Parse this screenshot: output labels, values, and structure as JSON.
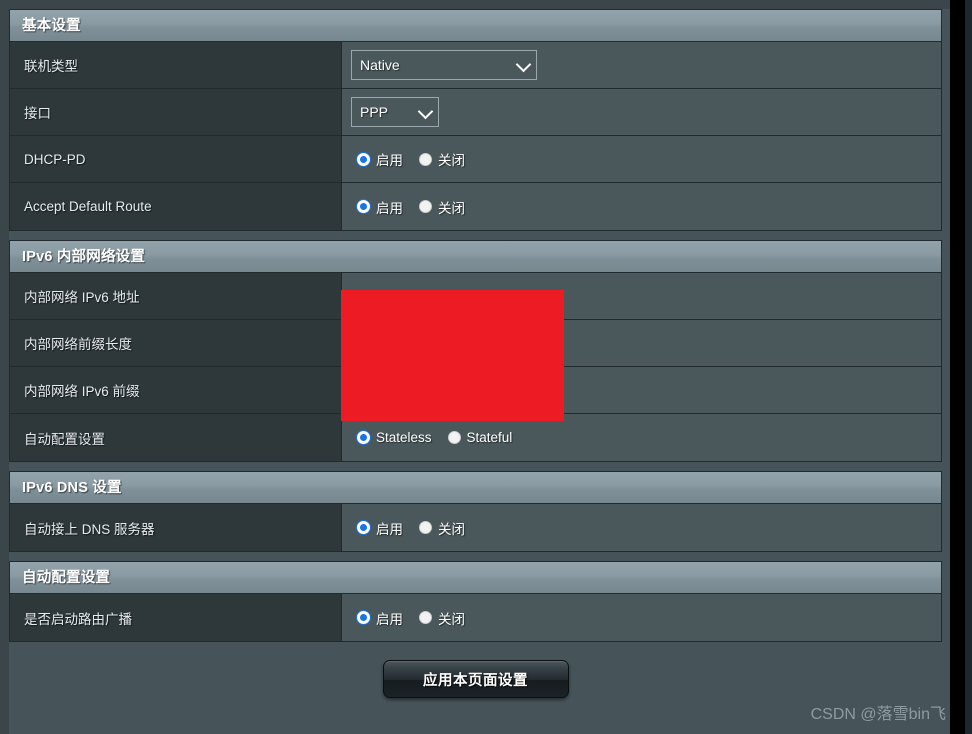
{
  "page": {
    "watermark": "CSDN @落雪bin飞",
    "accent_blue": "#1a73e8",
    "redaction_color": "#ed1c24",
    "panel_bg": "#2e383b",
    "value_bg": "#4a585c",
    "header_gradient_top": "#93a3ab",
    "header_gradient_bottom": "#78888f"
  },
  "sections": [
    {
      "title": "基本设置",
      "rows": [
        {
          "label": "联机类型",
          "control": "select-wide",
          "value": "Native",
          "icon": "chevron-down-icon"
        },
        {
          "label": "接口",
          "control": "select-narrow",
          "value": "PPP",
          "icon": "chevron-down-icon"
        },
        {
          "label": "DHCP-PD",
          "control": "radio",
          "options": [
            {
              "label": "启用",
              "selected": true
            },
            {
              "label": "关闭",
              "selected": false
            }
          ]
        },
        {
          "label": "Accept Default Route",
          "control": "radio",
          "options": [
            {
              "label": "启用",
              "selected": true
            },
            {
              "label": "关闭",
              "selected": false
            }
          ]
        }
      ]
    },
    {
      "title": "IPv6 内部网络设置",
      "rows": [
        {
          "label": "内部网络 IPv6 地址",
          "control": "redacted",
          "value": ""
        },
        {
          "label": "内部网络前缀长度",
          "control": "redacted",
          "value": ""
        },
        {
          "label": "内部网络 IPv6 前缀",
          "control": "redacted",
          "value": ""
        },
        {
          "label": "自动配置设置",
          "control": "radio",
          "options": [
            {
              "label": "Stateless",
              "selected": true
            },
            {
              "label": "Stateful",
              "selected": false
            }
          ]
        }
      ]
    },
    {
      "title": "IPv6 DNS 设置",
      "rows": [
        {
          "label": "自动接上 DNS 服务器",
          "control": "radio",
          "options": [
            {
              "label": "启用",
              "selected": true
            },
            {
              "label": "关闭",
              "selected": false
            }
          ]
        }
      ]
    },
    {
      "title": "自动配置设置",
      "rows": [
        {
          "label": "是否启动路由广播",
          "control": "radio",
          "options": [
            {
              "label": "启用",
              "selected": true
            },
            {
              "label": "关闭",
              "selected": false
            }
          ]
        }
      ]
    }
  ],
  "apply": {
    "label": "应用本页面设置"
  }
}
